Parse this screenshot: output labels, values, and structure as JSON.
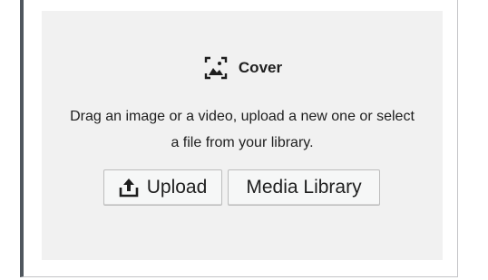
{
  "block": {
    "label": "Cover",
    "label_icon": "cover-image-icon",
    "instructions": "Drag an image or a video, upload a new one or select a file from your library."
  },
  "actions": {
    "upload_label": "Upload",
    "upload_icon": "upload-icon",
    "media_library_label": "Media Library"
  },
  "colors": {
    "placeholder_background": "#f1f1f1",
    "text": "#1e1e1e",
    "left_rule": "#50575e",
    "button_background": "#f6f7f7",
    "button_border": "#bdbdbd"
  }
}
